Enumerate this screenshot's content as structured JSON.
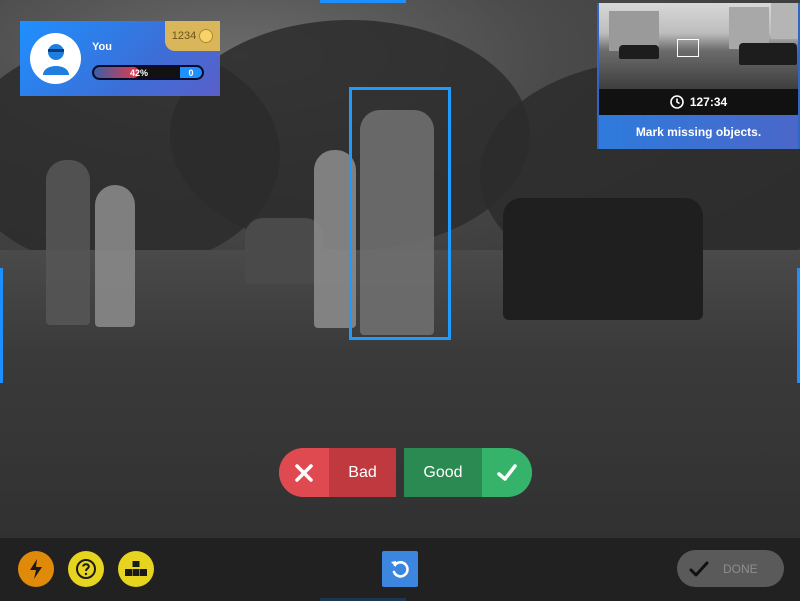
{
  "player": {
    "name": "You",
    "coins": "1234",
    "progress_percent": 42,
    "progress_label": "42%",
    "missing_count": "0"
  },
  "minimap": {
    "timer": "127:34",
    "instruction": "Mark missing objects."
  },
  "review": {
    "bad_label": "Bad",
    "good_label": "Good"
  },
  "toolbar": {
    "done_label": "DONE"
  },
  "icons": {
    "boost": "lightning-icon",
    "help": "question-icon",
    "tools": "boxes-icon",
    "undo": "undo-icon",
    "timer": "clock-icon",
    "bad": "x-icon",
    "good": "check-icon",
    "done": "check-icon",
    "coins": "coin-icon",
    "avatar": "user-avatar-icon"
  },
  "colors": {
    "accent": "#1e9bff",
    "bad": "#df4a50",
    "good": "#35b36a",
    "boost": "#e08a0a",
    "help": "#e6d41e",
    "tools": "#e6d41e"
  }
}
